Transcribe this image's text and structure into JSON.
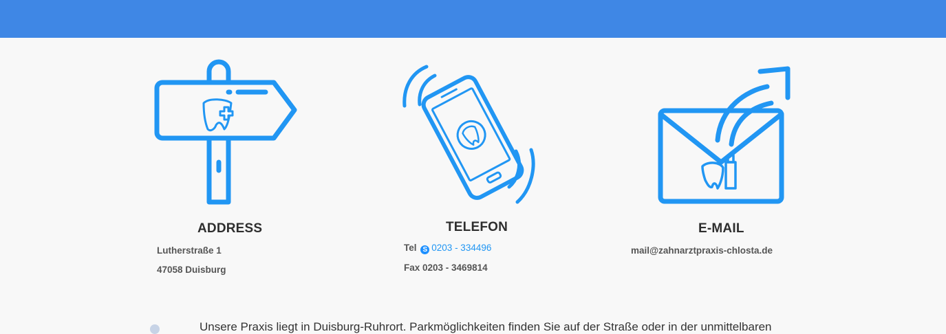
{
  "colors": {
    "header": "#3f87e5",
    "icon": "#2196f3",
    "heading": "#2e2e2e",
    "text": "#555555"
  },
  "address": {
    "icon": "signpost-tooth-icon",
    "heading": "ADDRESS",
    "street": "Lutherstraße 1",
    "city": "47058 Duisburg"
  },
  "telefon": {
    "icon": "smartphone-ringing-tooth-icon",
    "heading": "TELEFON",
    "tel_label": "Tel",
    "tel_number": "0203 - 334496",
    "fax": "Fax 0203 - 3469814"
  },
  "email": {
    "icon": "envelope-send-tooth-icon",
    "heading": "E-MAIL",
    "address": "mail@zahnarztpraxis-chlosta.de"
  },
  "footer": {
    "text": "Unsere Praxis liegt in Duisburg-Ruhrort. Parkmöglichkeiten finden Sie auf der Straße oder in der unmittelbaren"
  }
}
